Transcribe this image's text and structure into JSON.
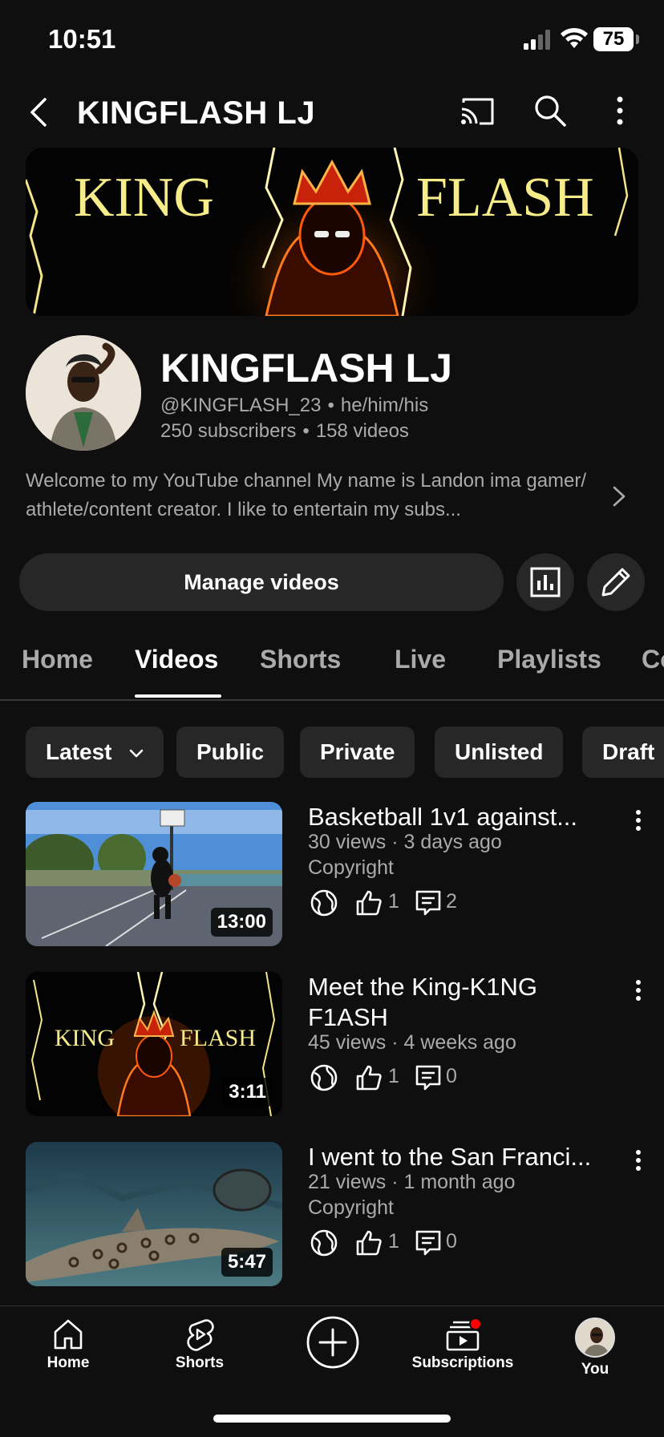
{
  "status_bar": {
    "time": "10:51",
    "battery": "75"
  },
  "header": {
    "title": "KINGFLASH LJ"
  },
  "banner": {
    "word_left": "KING",
    "word_right": "FLASH"
  },
  "channel": {
    "name": "KINGFLASH LJ",
    "handle": "@KINGFLASH_23",
    "pronouns": "he/him/his",
    "subscribers": "250 subscribers",
    "videos": "158 videos",
    "separator": "•",
    "description": "Welcome to my YouTube channel My name is Landon ima gamer/ athlete/content creator. I like to entertain my subs..."
  },
  "actions": {
    "manage_label": "Manage videos"
  },
  "tabs": [
    {
      "label": "Home"
    },
    {
      "label": "Videos",
      "active": true
    },
    {
      "label": "Shorts"
    },
    {
      "label": "Live"
    },
    {
      "label": "Playlists"
    },
    {
      "label": "Co"
    }
  ],
  "chips": [
    {
      "label": "Latest"
    },
    {
      "label": "Public"
    },
    {
      "label": "Private"
    },
    {
      "label": "Unlisted"
    },
    {
      "label": "Draft"
    }
  ],
  "videos": [
    {
      "title": "Basketball 1v1 against...",
      "meta": "30 views · 3 days ago",
      "restriction": "Copyright",
      "duration": "13:00",
      "likes": "1",
      "comments": "2"
    },
    {
      "title": "Meet the King-K1NG F1ASH",
      "meta": "45 views · 4 weeks ago",
      "restriction": "",
      "duration": "3:11",
      "likes": "1",
      "comments": "0",
      "thumb_text_left": "KING",
      "thumb_text_right": "FLASH"
    },
    {
      "title": "I went to the San Franci...",
      "meta": "21 views · 1 month ago",
      "restriction": "Copyright",
      "duration": "5:47",
      "likes": "1",
      "comments": "0"
    }
  ],
  "bottom_nav": {
    "home": "Home",
    "shorts": "Shorts",
    "subscriptions": "Subscriptions",
    "you": "You"
  },
  "colors": {
    "background": "#0f0f0f",
    "surface": "#272727",
    "secondary_text": "#aaaaaa",
    "notification": "#ff0000"
  }
}
